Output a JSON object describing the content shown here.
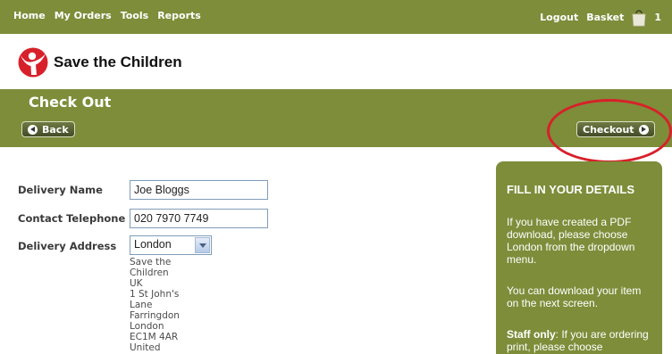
{
  "nav": {
    "items": [
      "Home",
      "My Orders",
      "Tools",
      "Reports"
    ],
    "logout": "Logout",
    "basket": "Basket",
    "basket_count": "1"
  },
  "brand": {
    "name": "Save the Children",
    "color": "#d8202a"
  },
  "header": {
    "title": "Check Out",
    "back_label": "Back",
    "checkout_label": "Checkout"
  },
  "form": {
    "delivery_name_label": "Delivery Name",
    "delivery_name_value": "Joe Bloggs",
    "contact_label": "Contact Telephone",
    "contact_value": "020 7970 7749",
    "address_label": "Delivery Address",
    "address_selected": "London",
    "address_lines": [
      "Save the Children UK",
      "1 St John's Lane",
      "Farringdon",
      "London",
      "EC1M 4AR",
      "United Kingdom"
    ]
  },
  "info": {
    "title": "FILL IN YOUR DETAILS",
    "p1": "If you have created a PDF download, please choose London from the dropdown menu.",
    "p2": "You can download your item on the next screen.",
    "p3_bold": "Staff only",
    "p3_rest": ": If you are ordering print, please choose"
  },
  "colors": {
    "accent": "#7d8d3a",
    "annotation": "#d8202a"
  }
}
